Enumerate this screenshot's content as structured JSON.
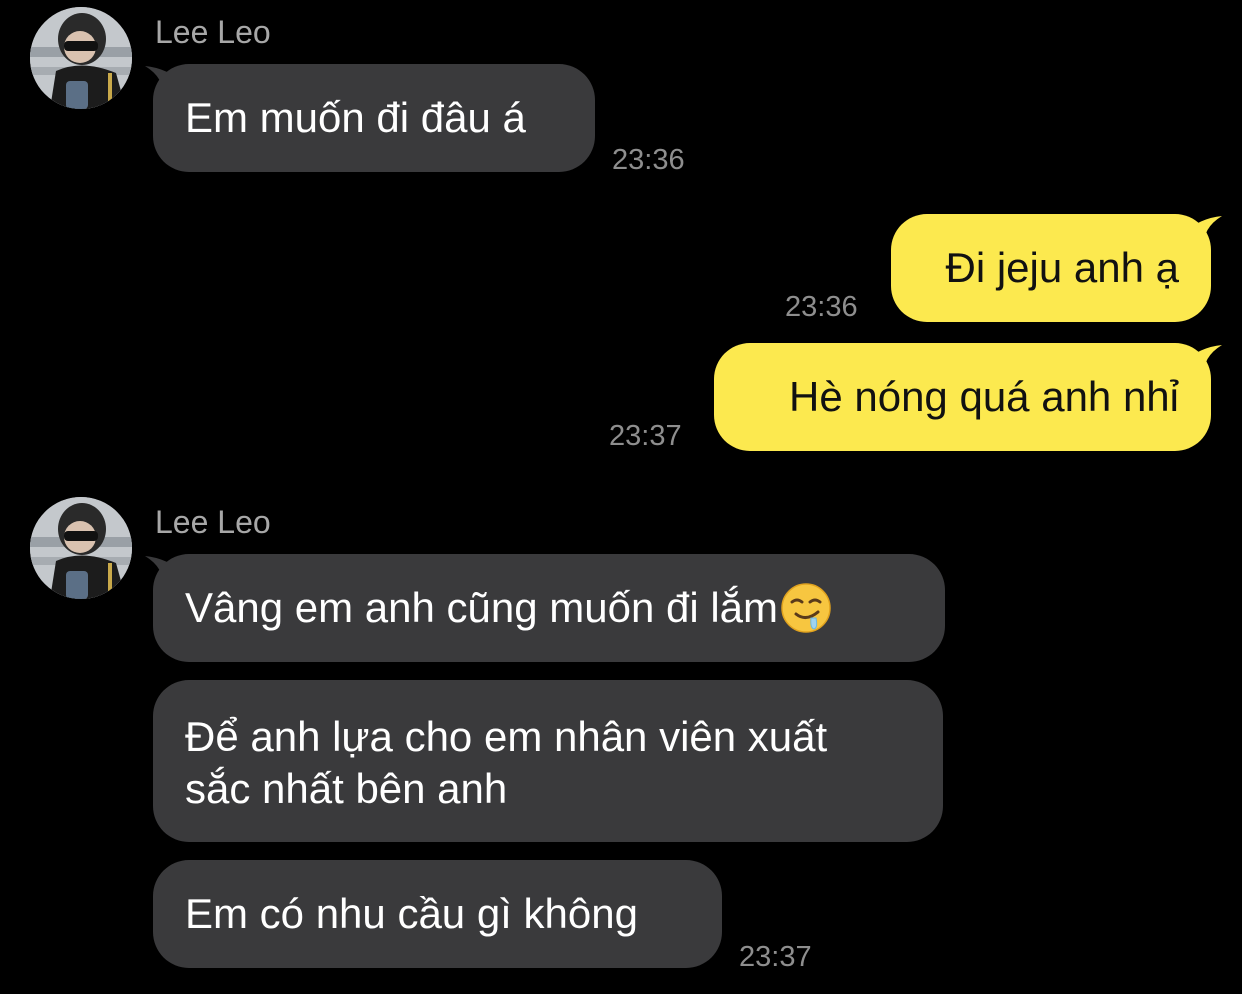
{
  "chat": {
    "messages": [
      {
        "sender": "Lee Leo",
        "text": "Em muốn đi đâu á",
        "time": "23:36"
      },
      {
        "text": "Đi jeju anh ạ",
        "time": "23:36"
      },
      {
        "text": "Hè nóng quá anh nhỉ",
        "time": "23:37"
      },
      {
        "sender": "Lee Leo",
        "text": "Vâng em anh cũng muốn đi lắm",
        "emoji": "drooling-face-icon"
      },
      {
        "line1": "Để anh lựa cho em nhân viên xuất",
        "line2": "sắc nhất bên anh"
      },
      {
        "text": "Em có nhu cầu gì không",
        "time": "23:37"
      }
    ]
  },
  "colors": {
    "background": "#000000",
    "incoming_bubble": "#3a3a3c",
    "outgoing_bubble": "#fce94f",
    "timestamp": "#8e8e8e",
    "sender_name": "#a7a7a7"
  }
}
